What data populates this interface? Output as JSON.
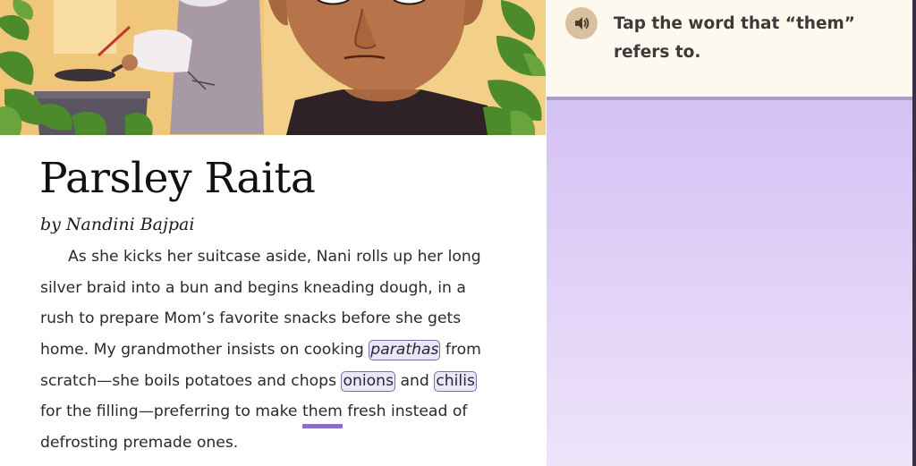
{
  "illustration": {
    "icon": "illustration-grandmother-cooking",
    "colors": {
      "sky": "#f2c774",
      "skin": "#b7744a",
      "leaves": "#4d8a2c",
      "shirt": "#2e2226"
    }
  },
  "story": {
    "title": "Parsley Raita",
    "byline": "by Nandini Bajpai",
    "lines": [
      {
        "text": "As she kicks her suitcase aside, Nani rolls up her long"
      },
      {
        "text": "silver braid into a bun and begins kneading dough, in a"
      },
      {
        "text": "rush to prepare Mom’s favorite snacks before she gets"
      },
      {
        "before": "home. My grandmother insists on cooking ",
        "chip": "parathas",
        "after": " from"
      },
      {
        "before": "scratch—she boils potatoes and chops ",
        "chip1": "onions",
        "mid": " and ",
        "chip2": "chilis"
      },
      {
        "before": "for the filling—preferring to make ",
        "target": "them",
        "after": " fresh instead of"
      },
      {
        "text": "defrosting premade ones."
      }
    ]
  },
  "task": {
    "audio_icon": "speaker-icon",
    "prompt": "Tap the word that “them” refers to.",
    "colors": {
      "card": "#fdf9ee",
      "chip_border": "#7f6bb0",
      "highlight": "#8f6ad0",
      "audio_button": "#d9c1a0"
    }
  }
}
